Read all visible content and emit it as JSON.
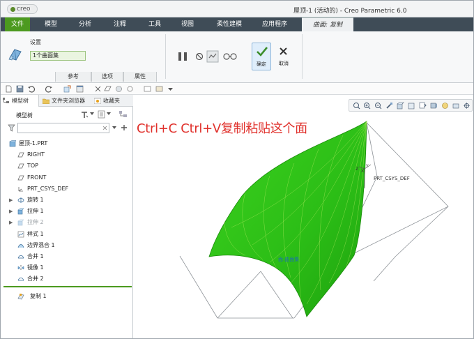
{
  "app": {
    "logo_text": "creo",
    "window_title": "屋顶-1 (活动的) - Creo Parametric 6.0"
  },
  "menu": {
    "items": [
      "文件",
      "模型",
      "分析",
      "注释",
      "工具",
      "视图",
      "柔性建模",
      "应用程序"
    ],
    "active_contextual_tab": "曲面: 复制"
  },
  "ribbon": {
    "settings_label": "设置",
    "surface_set_value": "1个曲面集",
    "subtabs": [
      "参考",
      "选项",
      "属性"
    ],
    "confirm_label": "确定",
    "cancel_label": "取消"
  },
  "left_panel": {
    "tabs": [
      "模型树",
      "文件夹浏览器",
      "收藏夹"
    ],
    "tree_title": "模型树",
    "filter_value": "",
    "items": [
      {
        "label": "屋顶-1.PRT",
        "icon": "part-icon",
        "indent": 0,
        "expander": "",
        "dim": false
      },
      {
        "label": "RIGHT",
        "icon": "datum-plane-icon",
        "indent": 1,
        "expander": "",
        "dim": false
      },
      {
        "label": "TOP",
        "icon": "datum-plane-icon",
        "indent": 1,
        "expander": "",
        "dim": false
      },
      {
        "label": "FRONT",
        "icon": "datum-plane-icon",
        "indent": 1,
        "expander": "",
        "dim": false
      },
      {
        "label": "PRT_CSYS_DEF",
        "icon": "csys-icon",
        "indent": 1,
        "expander": "",
        "dim": false
      },
      {
        "label": "旋转 1",
        "icon": "revolve-icon",
        "indent": 1,
        "expander": "▶",
        "dim": false
      },
      {
        "label": "拉伸 1",
        "icon": "extrude-icon",
        "indent": 1,
        "expander": "▶",
        "dim": false
      },
      {
        "label": "拉伸 2",
        "icon": "extrude-icon",
        "indent": 1,
        "expander": "▶",
        "dim": true
      },
      {
        "label": "样式 1",
        "icon": "style-icon",
        "indent": 1,
        "expander": "",
        "dim": false
      },
      {
        "label": "边界混合 1",
        "icon": "boundary-blend-icon",
        "indent": 1,
        "expander": "",
        "dim": false
      },
      {
        "label": "合并 1",
        "icon": "merge-icon",
        "indent": 1,
        "expander": "",
        "dim": false
      },
      {
        "label": "镜像 1",
        "icon": "mirror-icon",
        "indent": 1,
        "expander": "",
        "dim": false
      },
      {
        "label": "合并 2",
        "icon": "merge-icon",
        "indent": 1,
        "expander": "",
        "dim": false
      }
    ],
    "inserted_item": {
      "label": "复制 1",
      "icon": "copy-surface-icon"
    }
  },
  "viewport": {
    "annotation": "Ctrl+C Ctrl+V复制粘贴这个面",
    "csys_label": "PRT_CSYS_DEF",
    "surface_label": "面:曲面集",
    "axis_x": "X",
    "axis_y": "Y",
    "axis_z": "Z"
  },
  "colors": {
    "menu_bar": "#3f4c57",
    "file_tab": "#4c9a1f",
    "surface_green": "#2fbf17",
    "annotation_red": "#e0302b"
  }
}
